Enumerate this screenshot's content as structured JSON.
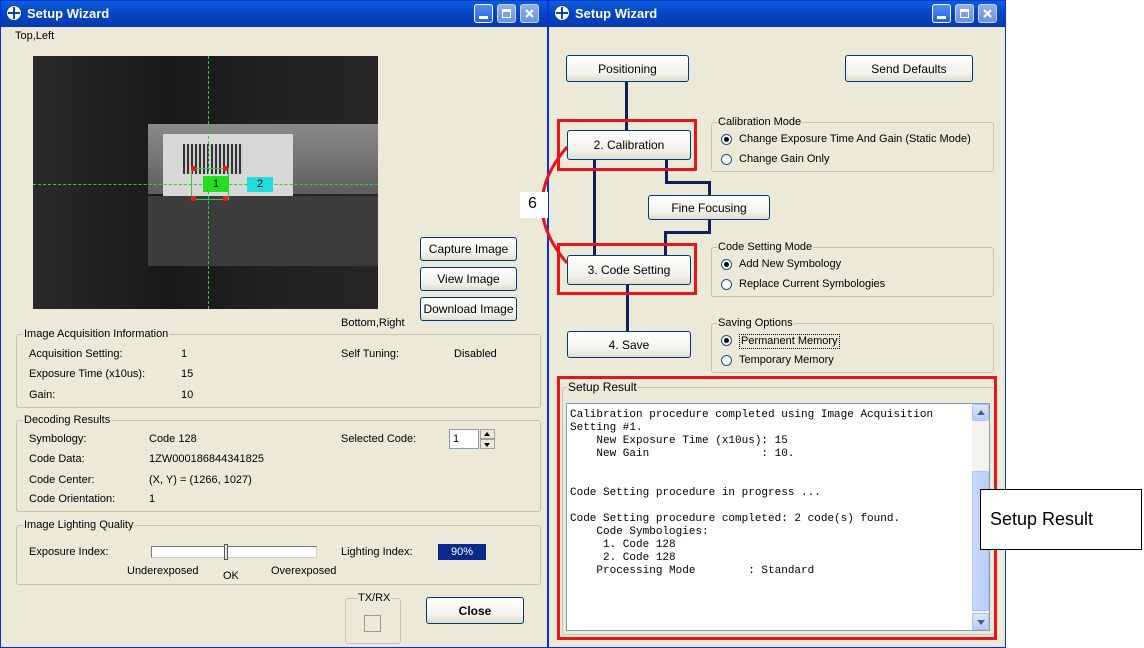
{
  "left_window": {
    "title": "Setup Wizard",
    "top_left_label": "Top,Left",
    "bottom_right_label": "Bottom,Right",
    "buttons": {
      "capture": "Capture Image",
      "view": "View Image",
      "download": "Download Image",
      "close": "Close"
    },
    "image_labels": [
      "1",
      "2"
    ],
    "acquisition": {
      "title": "Image Acquisition Information",
      "rows": [
        {
          "label": "Acquisition Setting:",
          "value": "1"
        },
        {
          "label": "Exposure Time (x10us):",
          "value": "15"
        },
        {
          "label": "Gain:",
          "value": "10"
        }
      ],
      "self_tuning_label": "Self Tuning:",
      "self_tuning_value": "Disabled"
    },
    "decoding": {
      "title": "Decoding Results",
      "rows": [
        {
          "label": "Symbology:",
          "value": "Code 128"
        },
        {
          "label": "Code Data:",
          "value": "1ZW000186844341825"
        },
        {
          "label": "Code Center:",
          "value": "(X, Y) = (1266, 1027)"
        },
        {
          "label": "Code Orientation:",
          "value": "1"
        }
      ],
      "selected_code_label": "Selected Code:",
      "selected_code_value": "1"
    },
    "lighting": {
      "title": "Image Lighting Quality",
      "exposure_label": "Exposure Index:",
      "underexposed": "Underexposed",
      "ok": "OK",
      "overexposed": "Overexposed",
      "lighting_label": "Lighting Index:",
      "lighting_value": "90%",
      "exposure_position": 0.45
    },
    "txrx_label": "TX/RX"
  },
  "right_window": {
    "title": "Setup Wizard",
    "buttons": {
      "positioning": "Positioning",
      "send_defaults": "Send Defaults",
      "calibration": "2. Calibration",
      "fine_focusing": "Fine Focusing",
      "code_setting": "3. Code Setting",
      "save": "4. Save"
    },
    "calibration_mode": {
      "title": "Calibration Mode",
      "options": [
        "Change Exposure Time And Gain (Static Mode)",
        "Change Gain Only"
      ],
      "selected": 0
    },
    "code_setting_mode": {
      "title": "Code Setting Mode",
      "options": [
        "Add New Symbology",
        "Replace Current Symbologies"
      ],
      "selected": 0
    },
    "saving_options": {
      "title": "Saving Options",
      "options": [
        "Permanent Memory",
        "Temporary Memory"
      ],
      "selected": 0
    },
    "setup_result": {
      "title": "Setup Result",
      "lines": [
        "Calibration procedure completed using Image Acquisition",
        "Setting #1.",
        "    New Exposure Time (x10us): 15",
        "    New Gain                 : 10.",
        "",
        "",
        "Code Setting procedure in progress ...",
        "",
        "Code Setting procedure completed: 2 code(s) found.",
        "    Code Symbologies:",
        "     1. Code 128",
        "     2. Code 128",
        "    Processing Mode        : Standard"
      ]
    }
  },
  "annotations": {
    "callout_number": "6",
    "setup_result_callout": "Setup Result"
  },
  "colors": {
    "title_bar": "#0746c6",
    "highlight": "#e8141c",
    "connector": "#0f1f5c",
    "code_label_1": "#22dd22",
    "code_label_2": "#22dddd",
    "lighting_index_bg": "#0a2a8a"
  }
}
